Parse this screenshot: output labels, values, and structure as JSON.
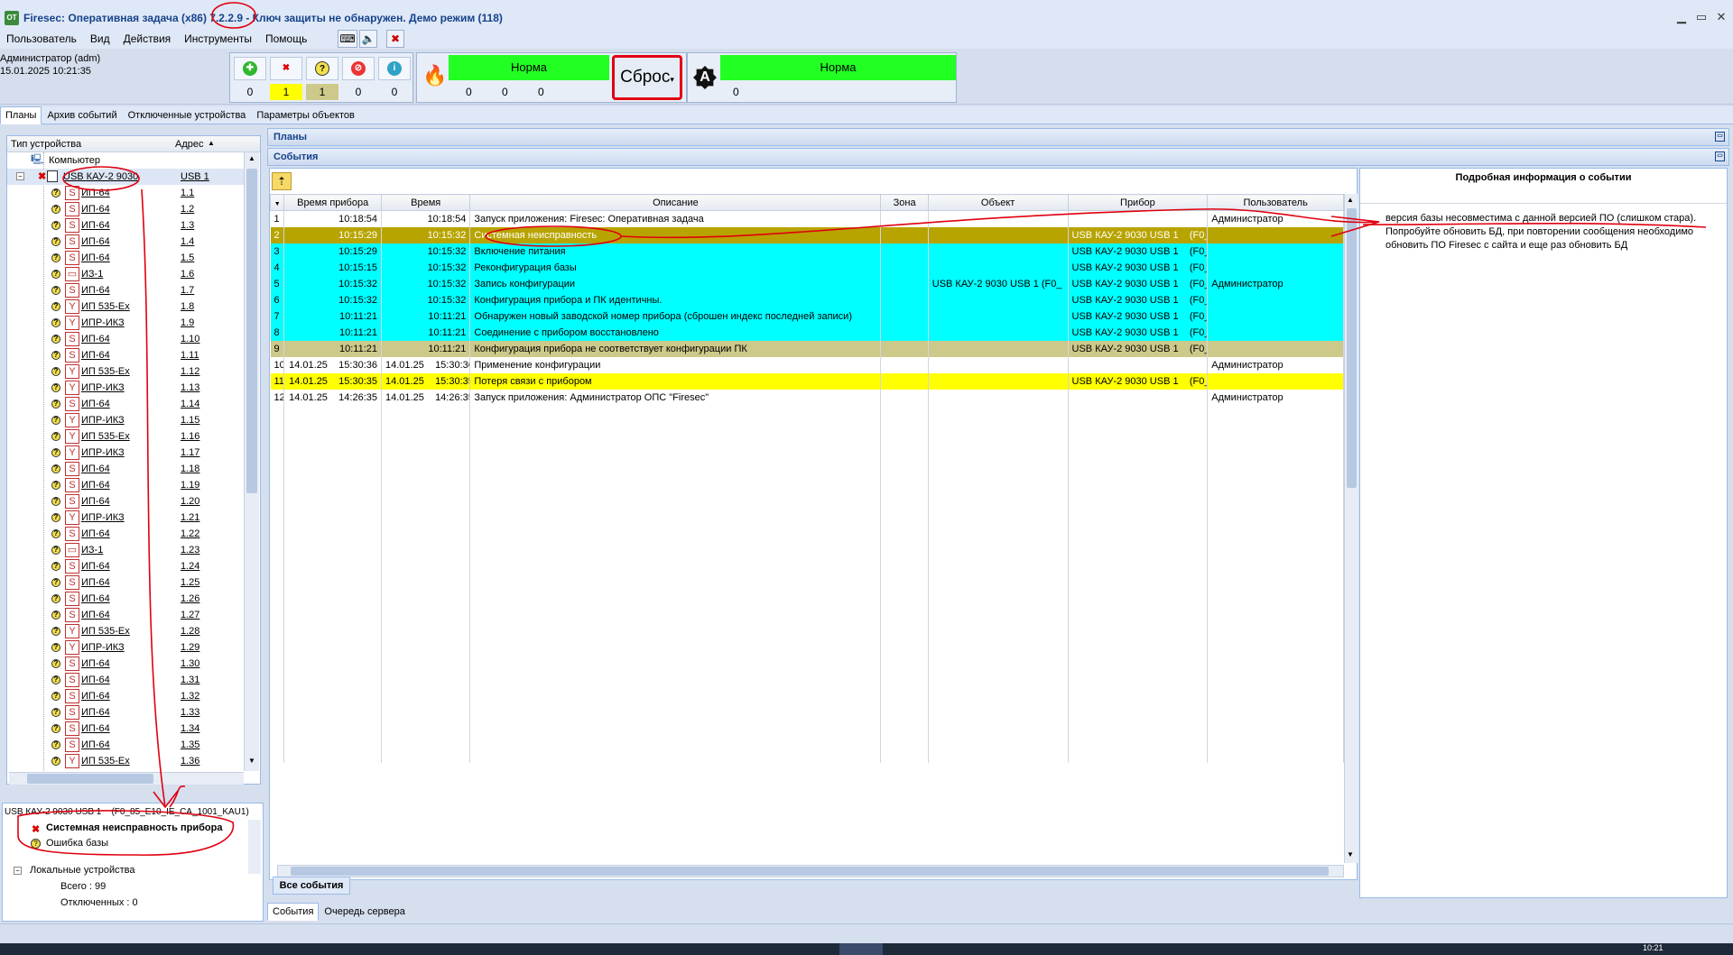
{
  "window": {
    "app_icon": "ОТ",
    "title": "Firesec: Оперативная задача  (x86) 7.2.2.9 - Ключ защиты не обнаружен. Демо режим (118)",
    "min": "▁",
    "max": "▭",
    "close": "✕"
  },
  "menu": [
    "Пользователь",
    "Вид",
    "Действия",
    "Инструменты",
    "Помощь"
  ],
  "user": {
    "name": "Администратор (adm)",
    "datetime": "15.01.2025  10:21:35"
  },
  "stats": [
    {
      "icon": "ok-icon",
      "value": "0",
      "color": "#e8eef8"
    },
    {
      "icon": "fault-icon",
      "value": "1",
      "color": "#ffff00"
    },
    {
      "icon": "question-icon",
      "value": "1",
      "color": "#cdc98a"
    },
    {
      "icon": "disabled-icon",
      "value": "0",
      "color": "#e8eef8"
    },
    {
      "icon": "info-icon",
      "value": "0",
      "color": "#e8eef8"
    }
  ],
  "fire": {
    "status": "Норма",
    "values": [
      "0",
      "0",
      "0"
    ]
  },
  "reset": {
    "label": "Сброс"
  },
  "auto": {
    "status": "Норма",
    "value": "0"
  },
  "tabs": [
    "Планы",
    "Архив событий",
    "Отключенные устройства",
    "Параметры объектов"
  ],
  "tree": {
    "col_type": "Тип устройства",
    "col_addr": "Адрес",
    "computer": "Компьютер",
    "root": {
      "name": "USB КАУ-2 9030",
      "addr": "USB 1"
    },
    "items": [
      {
        "name": "ИП-64",
        "addr": "1.1"
      },
      {
        "name": "ИП-64",
        "addr": "1.2"
      },
      {
        "name": "ИП-64",
        "addr": "1.3"
      },
      {
        "name": "ИП-64",
        "addr": "1.4"
      },
      {
        "name": "ИП-64",
        "addr": "1.5"
      },
      {
        "name": "ИЗ-1",
        "addr": "1.6"
      },
      {
        "name": "ИП-64",
        "addr": "1.7"
      },
      {
        "name": "ИП 535-Ex",
        "addr": "1.8"
      },
      {
        "name": "ИПР-ИКЗ",
        "addr": "1.9"
      },
      {
        "name": "ИП-64",
        "addr": "1.10"
      },
      {
        "name": "ИП-64",
        "addr": "1.11"
      },
      {
        "name": "ИП 535-Ex",
        "addr": "1.12"
      },
      {
        "name": "ИПР-ИКЗ",
        "addr": "1.13"
      },
      {
        "name": "ИП-64",
        "addr": "1.14"
      },
      {
        "name": "ИПР-ИКЗ",
        "addr": "1.15"
      },
      {
        "name": "ИП 535-Ex",
        "addr": "1.16"
      },
      {
        "name": "ИПР-ИКЗ",
        "addr": "1.17"
      },
      {
        "name": "ИП-64",
        "addr": "1.18"
      },
      {
        "name": "ИП-64",
        "addr": "1.19"
      },
      {
        "name": "ИП-64",
        "addr": "1.20"
      },
      {
        "name": "ИПР-ИКЗ",
        "addr": "1.21"
      },
      {
        "name": "ИП-64",
        "addr": "1.22"
      },
      {
        "name": "ИЗ-1",
        "addr": "1.23"
      },
      {
        "name": "ИП-64",
        "addr": "1.24"
      },
      {
        "name": "ИП-64",
        "addr": "1.25"
      },
      {
        "name": "ИП-64",
        "addr": "1.26"
      },
      {
        "name": "ИП-64",
        "addr": "1.27"
      },
      {
        "name": "ИП 535-Ex",
        "addr": "1.28"
      },
      {
        "name": "ИПР-ИКЗ",
        "addr": "1.29"
      },
      {
        "name": "ИП-64",
        "addr": "1.30"
      },
      {
        "name": "ИП-64",
        "addr": "1.31"
      },
      {
        "name": "ИП-64",
        "addr": "1.32"
      },
      {
        "name": "ИП-64",
        "addr": "1.33"
      },
      {
        "name": "ИП-64",
        "addr": "1.34"
      },
      {
        "name": "ИП-64",
        "addr": "1.35"
      },
      {
        "name": "ИП 535-Ex",
        "addr": "1.36"
      }
    ]
  },
  "device_status": {
    "device": "USB КАУ-2 9030 USB 1",
    "code": "(F0_85_E10_IE_CA_1001_KAU1)",
    "fault": "Системная неисправность прибора",
    "db_error": "Ошибка базы",
    "local": "Локальные устройства",
    "total": "Всего : 99",
    "disabled": "Отключенных : 0"
  },
  "sections": {
    "plans": "Планы",
    "events": "События"
  },
  "events": {
    "columns": [
      "",
      "Время прибора",
      "Время",
      "Описание",
      "Зона",
      "Объект",
      "Прибор",
      "Пользователь"
    ],
    "rows": [
      {
        "n": "1",
        "dev_date": "",
        "dev_time": "10:18:54",
        "date": "",
        "time": "10:18:54",
        "desc": "Запуск приложения: Firesec: Оперативная задача",
        "zone": "",
        "obj": "",
        "dev": "",
        "code": "",
        "user": "Администратор",
        "cls": "row-white"
      },
      {
        "n": "2",
        "dev_date": "",
        "dev_time": "10:15:29",
        "date": "",
        "time": "10:15:32",
        "desc": "Системная неисправность",
        "zone": "",
        "obj": "",
        "dev": "USB КАУ-2 9030 USB 1",
        "code": "(F0_",
        "user": "",
        "cls": "row-sel"
      },
      {
        "n": "3",
        "dev_date": "",
        "dev_time": "10:15:29",
        "date": "",
        "time": "10:15:32",
        "desc": "Включение питания",
        "zone": "",
        "obj": "",
        "dev": "USB КАУ-2 9030 USB 1",
        "code": "(F0_",
        "user": "",
        "cls": "row-cyan"
      },
      {
        "n": "4",
        "dev_date": "",
        "dev_time": "10:15:15",
        "date": "",
        "time": "10:15:32",
        "desc": "Реконфигурация базы",
        "zone": "",
        "obj": "",
        "dev": "USB КАУ-2 9030 USB 1",
        "code": "(F0_",
        "user": "",
        "cls": "row-cyan"
      },
      {
        "n": "5",
        "dev_date": "",
        "dev_time": "10:15:32",
        "date": "",
        "time": "10:15:32",
        "desc": "Запись конфигурации",
        "zone": "",
        "obj": "USB КАУ-2 9030 USB 1     (F0_",
        "dev": "USB КАУ-2 9030 USB 1",
        "code": "(F0_",
        "user": "Администратор",
        "cls": "row-cyan"
      },
      {
        "n": "6",
        "dev_date": "",
        "dev_time": "10:15:32",
        "date": "",
        "time": "10:15:32",
        "desc": "Конфигурация прибора и ПК идентичны.",
        "zone": "",
        "obj": "",
        "dev": "USB КАУ-2 9030 USB 1",
        "code": "(F0_",
        "user": "",
        "cls": "row-cyan"
      },
      {
        "n": "7",
        "dev_date": "",
        "dev_time": "10:11:21",
        "date": "",
        "time": "10:11:21",
        "desc": "Обнаружен новый заводской номер прибора (сброшен индекс последней записи)",
        "zone": "",
        "obj": "",
        "dev": "USB КАУ-2 9030 USB 1",
        "code": "(F0_",
        "user": "",
        "cls": "row-cyan"
      },
      {
        "n": "8",
        "dev_date": "",
        "dev_time": "10:11:21",
        "date": "",
        "time": "10:11:21",
        "desc": "Соединение с прибором восстановлено",
        "zone": "",
        "obj": "",
        "dev": "USB КАУ-2 9030 USB 1",
        "code": "(F0_",
        "user": "",
        "cls": "row-cyan"
      },
      {
        "n": "9",
        "dev_date": "",
        "dev_time": "10:11:21",
        "date": "",
        "time": "10:11:21",
        "desc": "Конфигурация прибора не соответствует конфигурации ПК",
        "zone": "",
        "obj": "",
        "dev": "USB КАУ-2 9030 USB 1",
        "code": "(F0_",
        "user": "",
        "cls": "row-olive"
      },
      {
        "n": "10",
        "dev_date": "14.01.25",
        "dev_time": "15:30:36",
        "date": "14.01.25",
        "time": "15:30:36",
        "desc": "Применение конфигурации",
        "zone": "",
        "obj": "",
        "dev": "",
        "code": "",
        "user": "Администратор",
        "cls": "row-white"
      },
      {
        "n": "11",
        "dev_date": "14.01.25",
        "dev_time": "15:30:35",
        "date": "14.01.25",
        "time": "15:30:35",
        "desc": "Потеря связи с прибором",
        "zone": "",
        "obj": "",
        "dev": "USB КАУ-2 9030 USB 1",
        "code": "(F0_",
        "user": "",
        "cls": "row-yellow"
      },
      {
        "n": "12",
        "dev_date": "14.01.25",
        "dev_time": "14:26:35",
        "date": "14.01.25",
        "time": "14:26:35",
        "desc": "Запуск приложения: Администратор ОПС \"Firesec\"",
        "zone": "",
        "obj": "",
        "dev": "",
        "code": "",
        "user": "Администратор",
        "cls": "row-white"
      }
    ],
    "all_tab": "Все события"
  },
  "detail": {
    "title": "Подробная информация о событии",
    "text": "версия базы несовместима с данной версией ПО (слишком стара). Попробуйте обновить БД, при повторении сообщения необходимо обновить ПО Firesec с сайта и еще раз обновить БД"
  },
  "bottom_tabs": [
    "События",
    "Очередь сервера"
  ],
  "taskbar_clock": "10:21"
}
